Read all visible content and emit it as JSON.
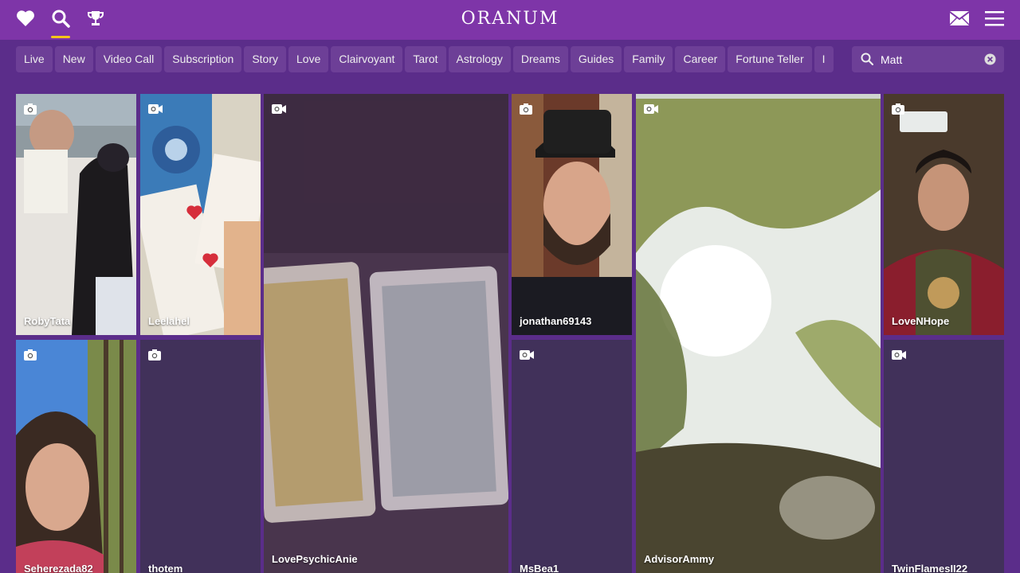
{
  "header": {
    "logo_text": "ORANUM",
    "icons": [
      "heart-icon",
      "search-icon",
      "trophy-icon",
      "mail-icon",
      "menu-icon"
    ],
    "accent_underline_color": "#f5c518"
  },
  "filters": [
    "Live",
    "New",
    "Video Call",
    "Subscription",
    "Story",
    "Love",
    "Clairvoyant",
    "Tarot",
    "Astrology",
    "Dreams",
    "Guides",
    "Family",
    "Career",
    "Fortune Teller",
    "I"
  ],
  "search": {
    "value": "Matt"
  },
  "advisors": [
    {
      "name": "RobyTata",
      "media": "photo"
    },
    {
      "name": "Leelahel",
      "media": "video"
    },
    {
      "name": "LovePsychicAnie",
      "media": "video"
    },
    {
      "name": "jonathan69143",
      "media": "photo"
    },
    {
      "name": "AdvisorAmmy",
      "media": "video"
    },
    {
      "name": "LoveNHope",
      "media": "photo"
    },
    {
      "name": "Seherezada82",
      "media": "photo"
    },
    {
      "name": "thotem",
      "media": "photo"
    },
    {
      "name": "MsBea1",
      "media": "video"
    },
    {
      "name": "TwinFlamesII22",
      "media": "video"
    }
  ],
  "colors": {
    "topbar": "#7e35a8",
    "page": "#5b2d8a",
    "chip": "#6d3f97",
    "empty_tile": "#41315a"
  }
}
